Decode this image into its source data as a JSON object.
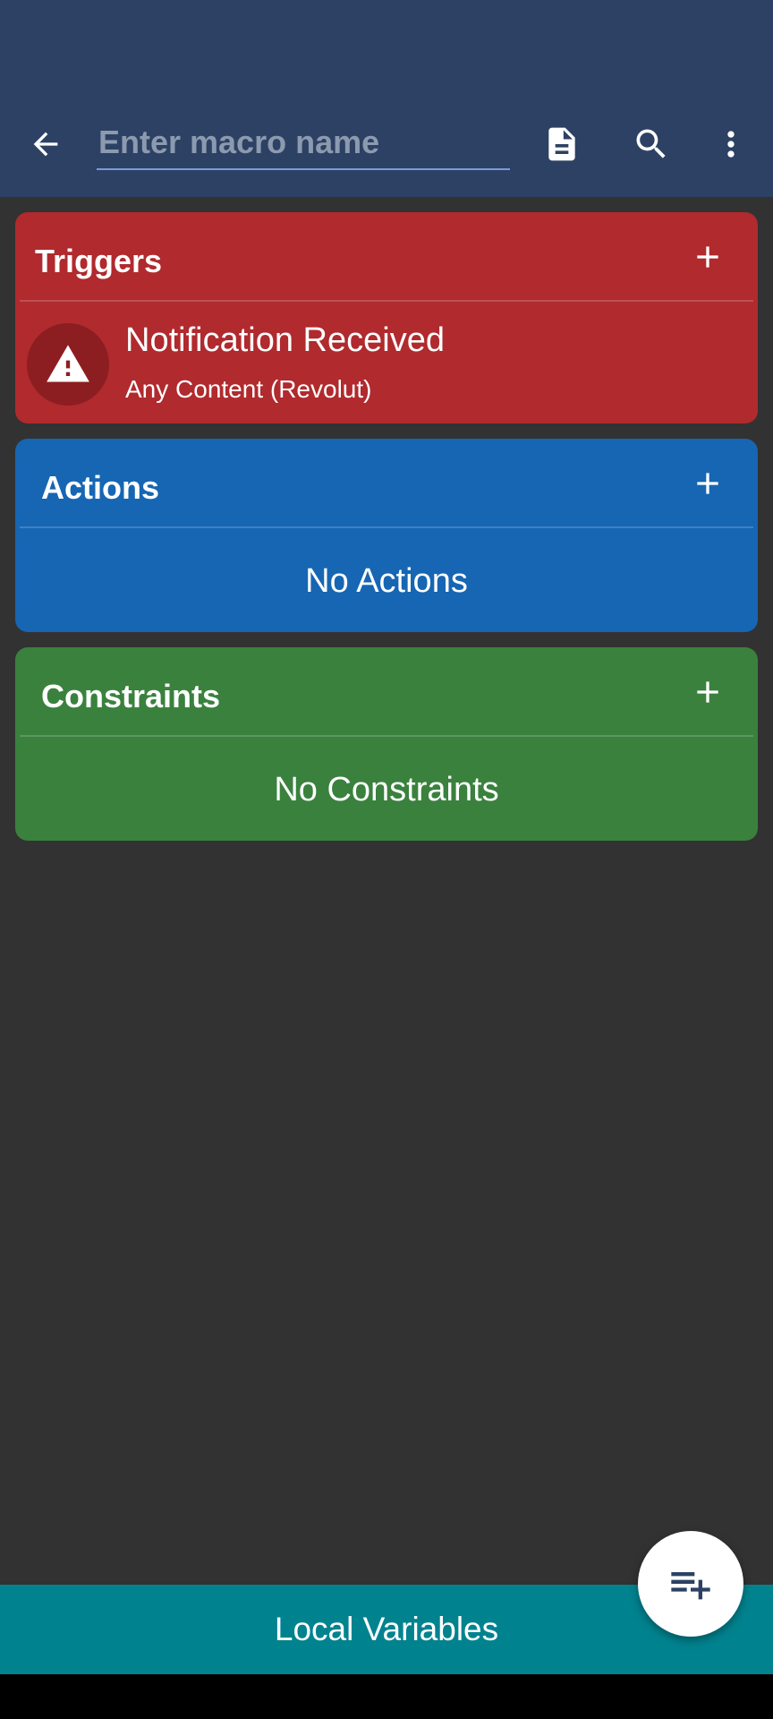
{
  "toolbar": {
    "name_placeholder": "Enter macro name",
    "name_value": "",
    "icons": [
      "arrow-back-icon",
      "document-icon",
      "search-icon",
      "more-vert-icon"
    ]
  },
  "sections": {
    "triggers": {
      "title": "Triggers",
      "color": "#b02a2e",
      "items": [
        {
          "title": "Notification Received",
          "subtitle": "Any Content (Revolut)",
          "icon": "warning-icon"
        }
      ]
    },
    "actions": {
      "title": "Actions",
      "color": "#1666b3",
      "empty_text": "No Actions"
    },
    "constraints": {
      "title": "Constraints",
      "color": "#3a813e",
      "empty_text": "No Constraints"
    }
  },
  "bottom_bar": {
    "label": "Local Variables",
    "color": "#00838f"
  },
  "fab": {
    "icon": "playlist-add-icon"
  },
  "colors": {
    "appbar": "#2c4163",
    "background": "#323232"
  }
}
